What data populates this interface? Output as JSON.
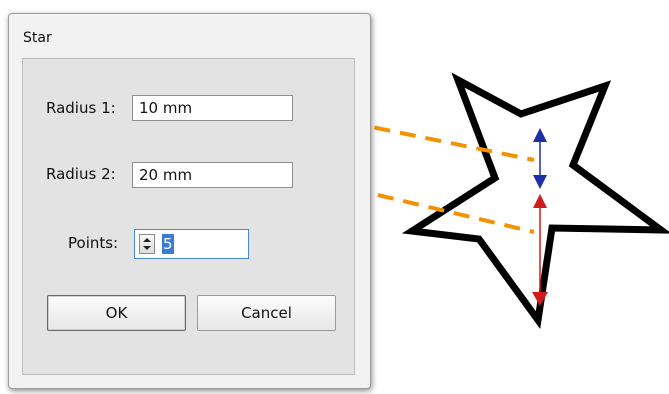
{
  "dialog": {
    "title": "Star",
    "radius1": {
      "label": "Radius 1:",
      "value": "10 mm"
    },
    "radius2": {
      "label": "Radius 2:",
      "value": "20 mm"
    },
    "points": {
      "label": "Points:",
      "value": "5"
    },
    "ok_label": "OK",
    "cancel_label": "Cancel"
  },
  "colors": {
    "connector": "#f39200",
    "radius1_arrow": "#1f2fa8",
    "radius2_arrow": "#d11a1a",
    "star_stroke": "#000000"
  },
  "icons": [
    "spin-up-icon",
    "spin-down-icon",
    "star-shape"
  ]
}
